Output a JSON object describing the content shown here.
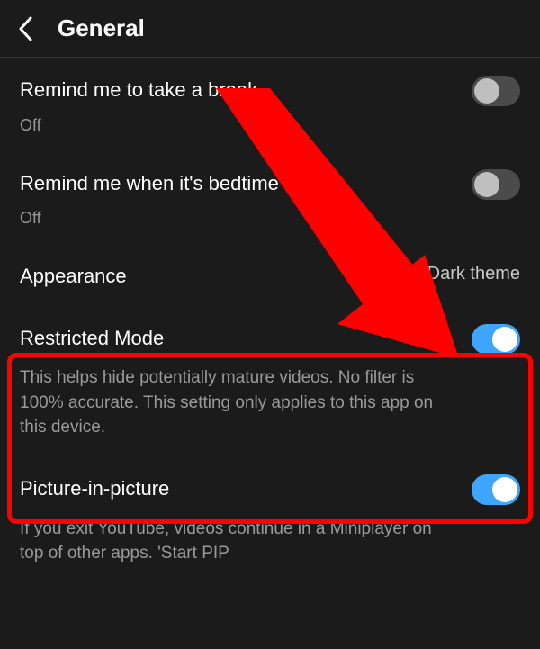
{
  "header": {
    "title": "General"
  },
  "settings": {
    "break": {
      "title": "Remind me to take a break",
      "value": "Off",
      "on": false
    },
    "bedtime": {
      "title": "Remind me when it's bedtime",
      "value": "Off",
      "on": false
    },
    "appearance": {
      "title": "Appearance",
      "value": "Dark theme"
    },
    "restricted": {
      "title": "Restricted Mode",
      "desc": "This helps hide potentially mature videos. No filter is 100% accurate. This setting only applies to this app on this device.",
      "on": true
    },
    "pip": {
      "title": "Picture-in-picture",
      "desc": "If you exit YouTube, videos continue in a Miniplayer on top of other apps. 'Start PIP",
      "on": true
    }
  },
  "annotation": {
    "type": "arrow",
    "color": "#ff0000",
    "points_to": "restricted-mode-toggle"
  }
}
